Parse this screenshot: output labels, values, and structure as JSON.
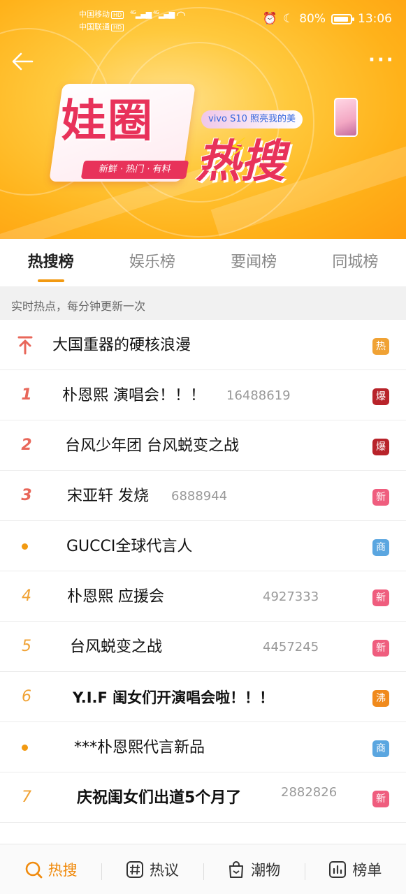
{
  "status_bar": {
    "carrier1": "中国移动",
    "carrier2": "中国联通",
    "hd": "HD",
    "net": "4G",
    "battery": "80%",
    "time": "13:06"
  },
  "banner": {
    "logo_main": "娃圈",
    "logo_hot": "热搜",
    "logo_sub": "新鲜 · 热门 · 有料",
    "sponsor_text": "vivo S10 照亮我的美"
  },
  "tabs": [
    {
      "label": "热搜榜",
      "active": true
    },
    {
      "label": "娱乐榜",
      "active": false
    },
    {
      "label": "要闻榜",
      "active": false
    },
    {
      "label": "同城榜",
      "active": false
    }
  ],
  "notice": "实时热点，每分钟更新一次",
  "list": [
    {
      "rank": "",
      "marker": "pin",
      "title": "大国重器的硬核浪漫",
      "count": "",
      "badge": "热",
      "badge_color": "#f0a234"
    },
    {
      "rank": "1",
      "marker": "top3",
      "title": "朴恩熙 演唱会！！！",
      "count": "16488619",
      "badge": "爆",
      "badge_color": "#b8232a"
    },
    {
      "rank": "2",
      "marker": "top3",
      "title": "台风少年团  台风蜕变之战",
      "count": "",
      "badge": "爆",
      "badge_color": "#b8232a"
    },
    {
      "rank": "3",
      "marker": "top3",
      "title": "宋亚轩  发烧",
      "count": "6888944",
      "badge": "新",
      "badge_color": "#ef5d7e"
    },
    {
      "rank": "",
      "marker": "dot",
      "title": "GUCCI全球代言人",
      "count": "",
      "badge": "商",
      "badge_color": "#5aa6e0"
    },
    {
      "rank": "4",
      "marker": "normal",
      "title": "朴恩熙  应援会",
      "count": "4927333",
      "badge": "新",
      "badge_color": "#ef5d7e"
    },
    {
      "rank": "5",
      "marker": "normal",
      "title": "台风蜕变之战",
      "count": "4457245",
      "badge": "新",
      "badge_color": "#ef5d7e"
    },
    {
      "rank": "6",
      "marker": "normal",
      "title": "Y.I.F  闺女们开演唱会啦！！！",
      "count": "",
      "badge": "沸",
      "badge_color": "#f08a1c"
    },
    {
      "rank": "",
      "marker": "dot",
      "title": "***朴恩熙代言新品",
      "count": "",
      "badge": "商",
      "badge_color": "#5aa6e0"
    },
    {
      "rank": "7",
      "marker": "normal",
      "title": "庆祝闺女们出道5个月了",
      "count": "2882826",
      "badge": "新",
      "badge_color": "#ef5d7e"
    }
  ],
  "bottom_nav": [
    {
      "label": "热搜",
      "icon": "search-icon",
      "active": true
    },
    {
      "label": "热议",
      "icon": "hash-icon",
      "active": false
    },
    {
      "label": "潮物",
      "icon": "shopping-bag-icon",
      "active": false
    },
    {
      "label": "榜单",
      "icon": "chart-icon",
      "active": false
    }
  ],
  "colors": {
    "accent": "#f29a12",
    "hot_red": "#e8675a"
  }
}
